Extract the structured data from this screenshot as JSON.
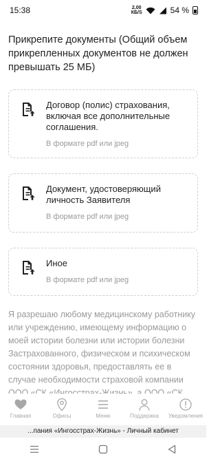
{
  "status_bar": {
    "time": "15:38",
    "net_speed_value": "2,00",
    "net_speed_unit": "КБ/S",
    "battery": "54 %"
  },
  "main": {
    "heading": "Прикрепите документы (Общий объем прикрепленных документов не должен превышать 25 МБ)",
    "cards": [
      {
        "title": "Договор (полис) страхования, включая все дополнительные соглашения.",
        "hint": "В формате pdf или jpeg"
      },
      {
        "title": "Документ, удостоверяющий личность Заявителя",
        "hint": "В формате pdf или jpeg"
      },
      {
        "title": "Иное",
        "hint": "В формате pdf или jpeg"
      }
    ],
    "consent_text": "Я разрешаю любому медицинскому работнику или учреждению, имеющему информацию о моей истории болезни или истории болезни Застрахованного, физическом и психическом состоянии здоровья, предоставлять ее в случае необходимости страховой компании ООО «СК «Ингосстрах-Жизнь», а ООО «СК «Ингосстрах-Жизнь»"
  },
  "bottom_nav": {
    "items": [
      {
        "label": "Главная",
        "icon": "heart-icon"
      },
      {
        "label": "Офисы",
        "icon": "location-pin-icon"
      },
      {
        "label": "Меню",
        "icon": "hamburger-menu-icon"
      },
      {
        "label": "Поддержка",
        "icon": "person-icon"
      },
      {
        "label": "Уведомления",
        "icon": "exclamation-circle-icon"
      }
    ]
  },
  "browser_bar": {
    "title": "...пания «Ингосстрах-Жизнь» - Личный кабинет"
  },
  "colors": {
    "text": "#222222",
    "muted": "#9a9a9a",
    "border": "#cfcfcf",
    "nav_icon": "#a7a7a7"
  }
}
